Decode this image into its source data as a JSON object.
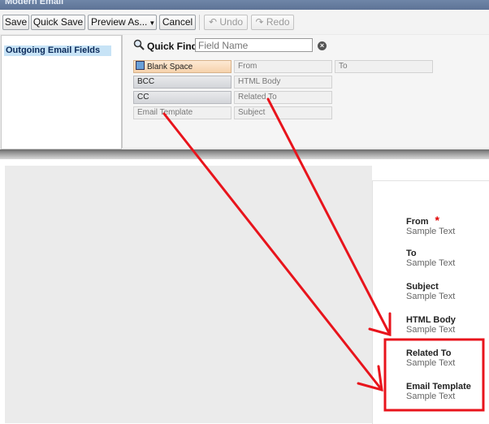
{
  "window": {
    "title": "Modern Email"
  },
  "toolbar": {
    "save": "Save",
    "quick_save": "Quick Save",
    "preview_as": "Preview As...",
    "cancel": "Cancel",
    "undo": "Undo",
    "redo": "Redo"
  },
  "sidebar": {
    "selected_item": "Outgoing Email Fields"
  },
  "quick_find": {
    "label": "Quick Find",
    "placeholder": "Field Name"
  },
  "fields": {
    "blank_space": "Blank Space",
    "from": "From",
    "to": "To",
    "bcc": "BCC",
    "html_body": "HTML Body",
    "cc": "CC",
    "related_to": "Related To",
    "email_template": "Email Template",
    "subject": "Subject"
  },
  "layout_fields": [
    {
      "label": "From",
      "value": "Sample Text",
      "required": true
    },
    {
      "label": "To",
      "value": "Sample Text"
    },
    {
      "label": "Subject",
      "value": "Sample Text"
    },
    {
      "label": "HTML Body",
      "value": "Sample Text"
    },
    {
      "label": "Related To",
      "value": "Sample Text"
    },
    {
      "label": "Email Template",
      "value": "Sample Text"
    }
  ],
  "required_marker": "*",
  "colors": {
    "annotation": "#e8141c",
    "selection": "#c7e3f6"
  }
}
